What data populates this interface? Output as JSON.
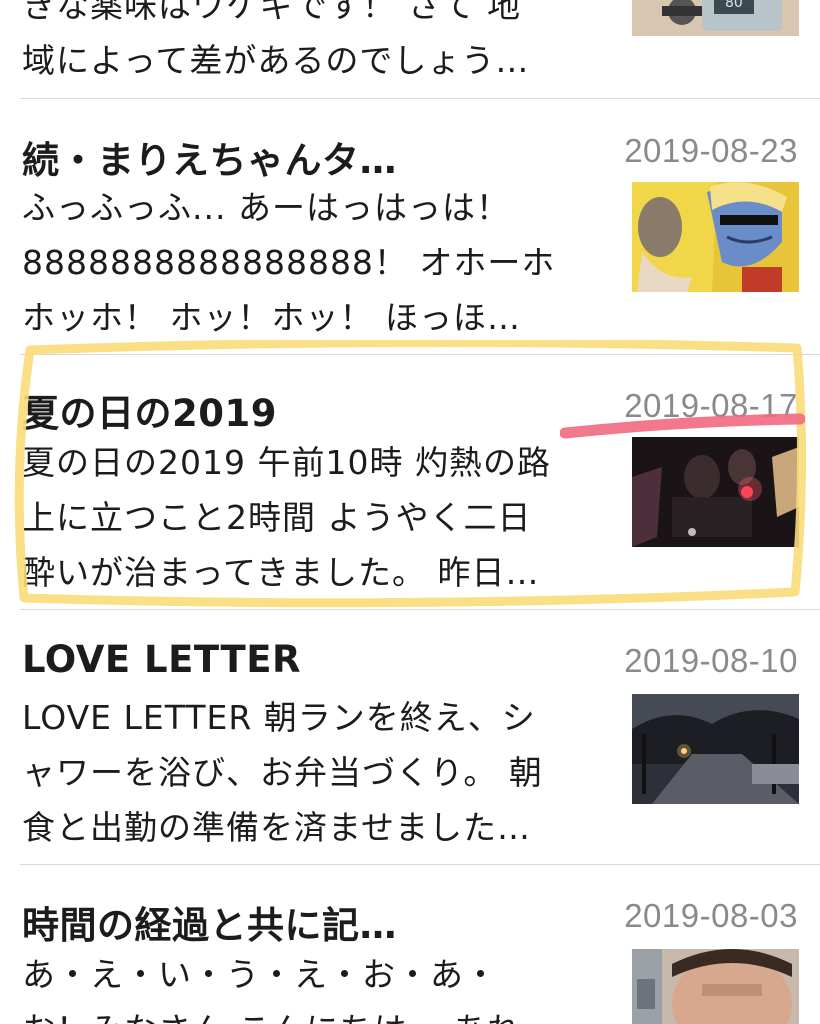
{
  "entries": [
    {
      "title": "",
      "date": "",
      "excerpt_lines": [
        "きな薬味はワケギです！ さて 地",
        "域によって差があるのでしょう…"
      ],
      "thumbnail": "device-photo-thumbnail"
    },
    {
      "title": "続・まりえちゃんタ…",
      "date": "2019-08-23",
      "excerpt_lines": [
        "ふっふっふ... あーはっはっは！",
        "8888888888888888！ オホーホ",
        "ホッホ！ ホッ！ホッ！ ほっほ…"
      ],
      "thumbnail": "anime-character-thumbnail"
    },
    {
      "title": "夏の日の2019",
      "date": "2019-08-17",
      "excerpt_lines": [
        "夏の日の2019 午前10時 灼熱の路",
        "上に立つこと2時間 ようやく二日",
        "酔いが治まってきました。 昨日…"
      ],
      "thumbnail": "night-party-thumbnail"
    },
    {
      "title": "LOVE  LETTER",
      "date": "2019-08-10",
      "excerpt_lines": [
        "LOVE LETTER 朝ランを終え、シ",
        "ャワーを浴び、お弁当づくり。 朝",
        "食と出勤の準備を済ませました…"
      ],
      "thumbnail": "night-street-thumbnail"
    },
    {
      "title": "時間の経過と共に記…",
      "date": "2019-08-03",
      "excerpt_lines": [
        "あ・え・い・う・え・お・あ・",
        "お！みなさん こんにちは。 あれ"
      ],
      "thumbnail": "blurred-face-thumbnail"
    }
  ],
  "annotations": {
    "highlight_color": "#f9dc7a",
    "underline_color": "#f06a7e"
  }
}
